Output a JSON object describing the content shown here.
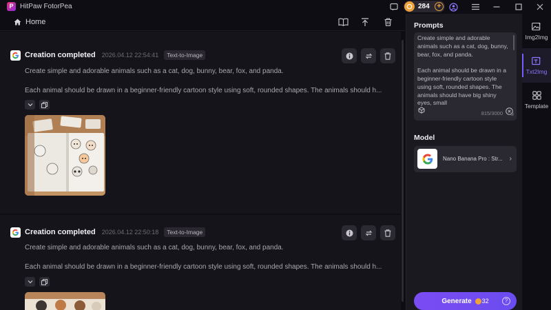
{
  "titlebar": {
    "app_title": "HitPaw FotorPea",
    "credits": "284"
  },
  "toolbar": {
    "home_label": "Home"
  },
  "feed": {
    "cards": [
      {
        "title": "Creation completed",
        "timestamp": "2026.04.12  22:54:41",
        "badge": "Text-to-Image",
        "prompt_line1": "Create simple and adorable animals such as a cat, dog, bunny, bear, fox, and panda.",
        "prompt_line2": "Each animal should be drawn in a beginner-friendly cartoon style using soft, rounded shapes. The animals should h..."
      },
      {
        "title": "Creation completed",
        "timestamp": "2026.04.12  22:50:18",
        "badge": "Text-to-Image",
        "prompt_line1": "Create simple and adorable animals such as a cat, dog, bunny, bear, fox, and panda.",
        "prompt_line2": "Each animal should be drawn in a beginner-friendly cartoon style using soft, rounded shapes. The animals should h..."
      }
    ]
  },
  "panel": {
    "prompts_heading": "Prompts",
    "prompt_para1": "Create simple and adorable animals such as a cat, dog, bunny, bear, fox, and panda.",
    "prompt_para2": "Each animal should be drawn in a beginner-friendly cartoon style using soft, rounded shapes. The animals should have big shiny eyes, small",
    "char_count": "815/3000",
    "model_heading": "Model",
    "model_name": "Nano Banana Pro : Str...",
    "generate_label": "Generate",
    "generate_cost": "32"
  },
  "rail": {
    "items": [
      {
        "label": "Img2Img",
        "icon": "image-icon"
      },
      {
        "label": "Txt2Img",
        "icon": "text-to-image-icon"
      },
      {
        "label": "Template",
        "icon": "template-icon"
      }
    ]
  },
  "colors": {
    "accent": "#7a5cff",
    "coin": "#f0a23a",
    "background": "#0f0d14"
  }
}
